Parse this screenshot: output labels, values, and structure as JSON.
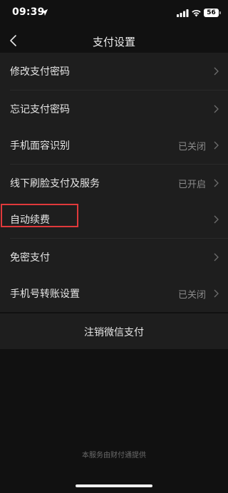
{
  "status_bar": {
    "time": "09:39",
    "battery": "56"
  },
  "header": {
    "title": "支付设置"
  },
  "groups": [
    {
      "items": [
        {
          "label": "修改支付密码",
          "value": ""
        },
        {
          "label": "忘记支付密码",
          "value": ""
        }
      ]
    },
    {
      "items": [
        {
          "label": "手机面容识别",
          "value": "已关闭"
        },
        {
          "label": "线下刷脸支付及服务",
          "value": "已开启"
        }
      ]
    },
    {
      "items": [
        {
          "label": "自动续费",
          "value": ""
        },
        {
          "label": "免密支付",
          "value": ""
        }
      ]
    },
    {
      "items": [
        {
          "label": "手机号转账设置",
          "value": "已关闭"
        }
      ]
    }
  ],
  "cancel_label": "注销微信支付",
  "footer": "本服务由财付通提供",
  "colors": {
    "background": "#111111",
    "card": "#1e1e1e",
    "highlight": "#e0393b"
  }
}
